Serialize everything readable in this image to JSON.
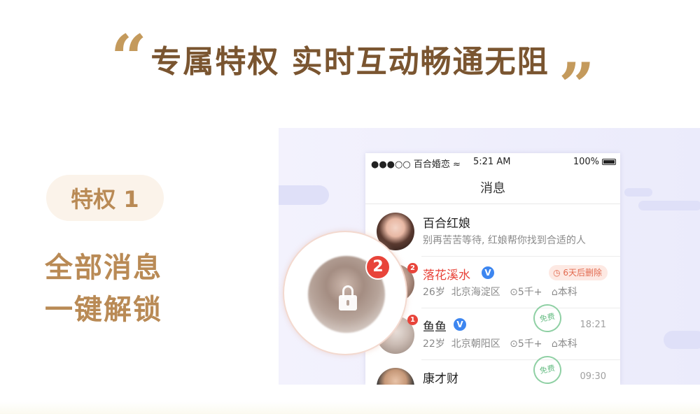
{
  "header": {
    "title": "专属特权  实时互动畅通无阻",
    "open_quote": "“",
    "close_quote": "”"
  },
  "feature": {
    "badge": "特权 1",
    "line1": "全部消息",
    "line2": "一键解锁"
  },
  "phone": {
    "status": {
      "carrier": "●●●○○ 百合婚恋 ≈",
      "time": "5:21 AM",
      "battery": "100%"
    },
    "nav_title": "消息",
    "messages": [
      {
        "name": "百合红娘",
        "preview": "别再苦苦等待, 红娘帮你找到合适的人"
      },
      {
        "name": "落花溪水",
        "verified": "V",
        "tag": "6天后删除",
        "unread": "2",
        "age": "26岁",
        "location": "北京海淀区",
        "income": "5千+",
        "education": "本科"
      },
      {
        "name": "鱼鱼",
        "verified": "V",
        "stamp": "免费",
        "time": "18:21",
        "unread": "1",
        "age": "22岁",
        "location": "北京朝阳区",
        "income": "5千+",
        "education": "本科"
      },
      {
        "name": "康才财",
        "stamp": "免费",
        "time": "09:30"
      }
    ],
    "lens_badge": "2"
  },
  "colors": {
    "headline": "#7a5530",
    "accent": "#b98a55",
    "quote": "#c49a5c",
    "unread_red": "#e8443a",
    "verified_blue": "#3d86f0",
    "free_green": "#6cbf88"
  },
  "icons": [
    "lock-icon",
    "verified-icon",
    "clock-icon",
    "location-icon",
    "education-icon",
    "wifi-icon",
    "battery-icon"
  ]
}
